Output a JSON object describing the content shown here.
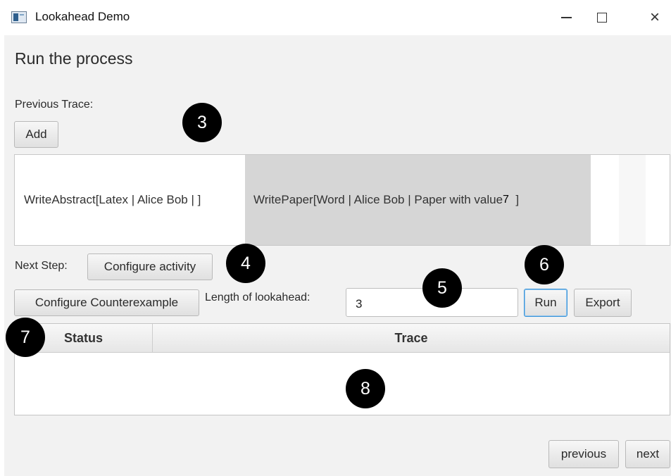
{
  "window": {
    "title": "Lookahead Demo",
    "controls": {
      "minimize": "minimize-icon",
      "maximize": "maximize-icon",
      "close": "×"
    }
  },
  "heading": "Run the process",
  "previous_trace": {
    "label": "Previous Trace:",
    "add_button": "Add",
    "items": [
      {
        "text": "WriteAbstract[Latex  | Alice Bob  | ]"
      },
      {
        "text": "WritePaper[Word  | Alice Bob  | Paper with value ",
        "value": "7",
        "suffix": "  ]"
      }
    ]
  },
  "next_step": {
    "label": "Next Step:",
    "configure_activity": "Configure activity",
    "configure_counterexample": "Configure Counterexample",
    "lookahead_label": "Length of lookahead:",
    "lookahead_value": "3",
    "run_button": "Run",
    "export_button": "Export"
  },
  "table": {
    "columns": [
      "Status",
      "Trace"
    ]
  },
  "navigation": {
    "previous": "previous",
    "next": "next"
  },
  "annotations": [
    "3",
    "4",
    "5",
    "6",
    "7",
    "8"
  ],
  "colors": {
    "focus_border": "#3d95d8",
    "selected_item_bg": "#d6d6d6",
    "marker_bg": "#000000"
  }
}
